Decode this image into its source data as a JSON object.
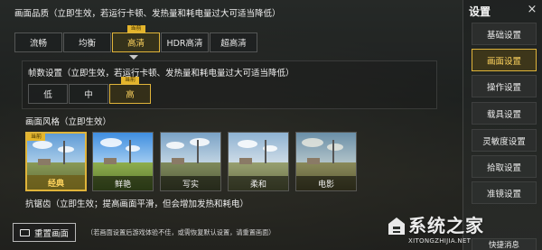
{
  "quality": {
    "title": "画面品质（立即生效，若运行卡顿、发热量和耗电量过大可适当降低）",
    "current_tag": "当前",
    "options": [
      "流畅",
      "均衡",
      "高清",
      "HDR高清",
      "超高清"
    ],
    "selected": "高清"
  },
  "fps": {
    "title": "帧数设置（立即生效，若运行卡顿、发热量和耗电量过大可适当降低）",
    "current_tag": "当前",
    "options": [
      "低",
      "中",
      "高"
    ],
    "selected": "高"
  },
  "style": {
    "title": "画面风格（立即生效）",
    "current_tag": "当前",
    "options": [
      "经典",
      "鲜艳",
      "写实",
      "柔和",
      "电影"
    ],
    "selected": "经典"
  },
  "antialias": {
    "title": "抗锯齿（立即生效；提高画面平滑，但会增加发热和耗电）"
  },
  "reset": {
    "label": "重置画面",
    "tip": "（若画面设置后游戏体验不佳，或需恢复默认设置，请重置画面）"
  },
  "sidebar": {
    "title": "设置",
    "close": "×",
    "items": [
      "基础设置",
      "画面设置",
      "操作设置",
      "载具设置",
      "灵敏度设置",
      "拾取设置",
      "准镜设置"
    ],
    "selected": "画面设置",
    "bottom_partial": "快捷消息"
  },
  "watermark": {
    "title": "系统之家",
    "url": "XITONGZHIJIA.NET"
  },
  "colors": {
    "accent": "#e0b43a",
    "accent_text": "#ffd45e"
  }
}
